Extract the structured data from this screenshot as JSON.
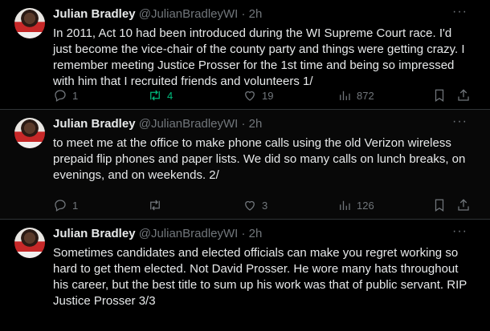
{
  "tweets": [
    {
      "name": "Julian Bradley",
      "handle": "@JulianBradleyWI",
      "dot": "·",
      "time": "2h",
      "more": "···",
      "text": "In 2011, Act 10 had been introduced during the WI Supreme Court race. I'd just become the vice-chair of the county party and things were getting crazy. I remember meeting Justice Prosser for the 1st time and being so impressed with him that I recruited friends and volunteers 1/",
      "replies": "1",
      "retweets": "4",
      "likes": "19",
      "views": "872"
    },
    {
      "name": "Julian Bradley",
      "handle": "@JulianBradleyWI",
      "dot": "·",
      "time": "2h",
      "more": "···",
      "text": "to meet me at the office to make phone calls using the old Verizon wireless prepaid flip phones and paper lists. We did so many calls on lunch breaks, on evenings, and on weekends. 2/",
      "replies": "1",
      "retweets": "",
      "likes": "3",
      "views": "126"
    },
    {
      "name": "Julian Bradley",
      "handle": "@JulianBradleyWI",
      "dot": "·",
      "time": "2h",
      "more": "···",
      "text": "Sometimes candidates and elected officials can make you regret working so hard to get them elected. Not David Prosser. He wore many hats throughout his career, but the best title to sum up his work was that of public servant. RIP Justice Prosser 3/3"
    }
  ],
  "colors": {
    "retweet_active": "#00ba7c",
    "muted": "#71767b",
    "text": "#e7e9ea",
    "background": "#000000"
  },
  "icons": [
    "reply-icon",
    "retweet-icon",
    "like-icon",
    "views-icon",
    "bookmark-icon",
    "share-icon"
  ]
}
